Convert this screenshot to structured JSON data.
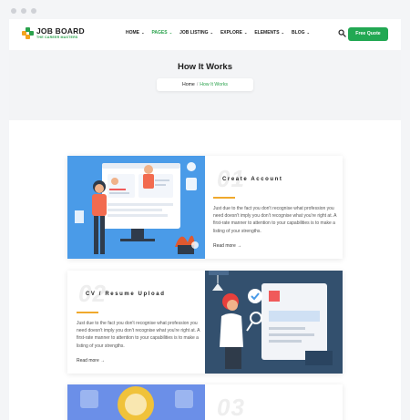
{
  "header": {
    "logo_title": "JOB BOARD",
    "logo_subtitle": "THE CAREER MASTERS",
    "nav": [
      {
        "label": "HOME",
        "active": false
      },
      {
        "label": "PAGES",
        "active": true
      },
      {
        "label": "JOB LISTING",
        "active": false
      },
      {
        "label": "EXPLORE",
        "active": false
      },
      {
        "label": "ELEMENTS",
        "active": false
      },
      {
        "label": "BLOG",
        "active": false
      }
    ],
    "quote_button": "Free Quote"
  },
  "hero": {
    "title": "How It Works",
    "breadcrumb_home": "Home",
    "breadcrumb_sep": "/",
    "breadcrumb_current": "How It Works"
  },
  "steps": [
    {
      "number": "01",
      "title": "Create Account",
      "description": "Just due to the fact you don't recognise what profession you need doesn't imply you don't recognise what you're right at. A first-rate manner to attention to your capabilities is to make a listing of your strengths.",
      "read_more": "Read more"
    },
    {
      "number": "02",
      "title": "CV / Resume Upload",
      "description": "Just due to the fact you don't recognise what profession you need doesn't imply you don't recognise what you're right at. A first-rate manner to attention to your capabilities is to make a listing of your strengths.",
      "read_more": "Read more",
      "image_label": "CURRICULUM VITAE"
    },
    {
      "number": "03"
    }
  ],
  "colors": {
    "brand_green": "#22a853",
    "accent_orange": "#f0a92c",
    "illustration_blue": "#4a9be8",
    "illustration_navy": "#33506e"
  }
}
